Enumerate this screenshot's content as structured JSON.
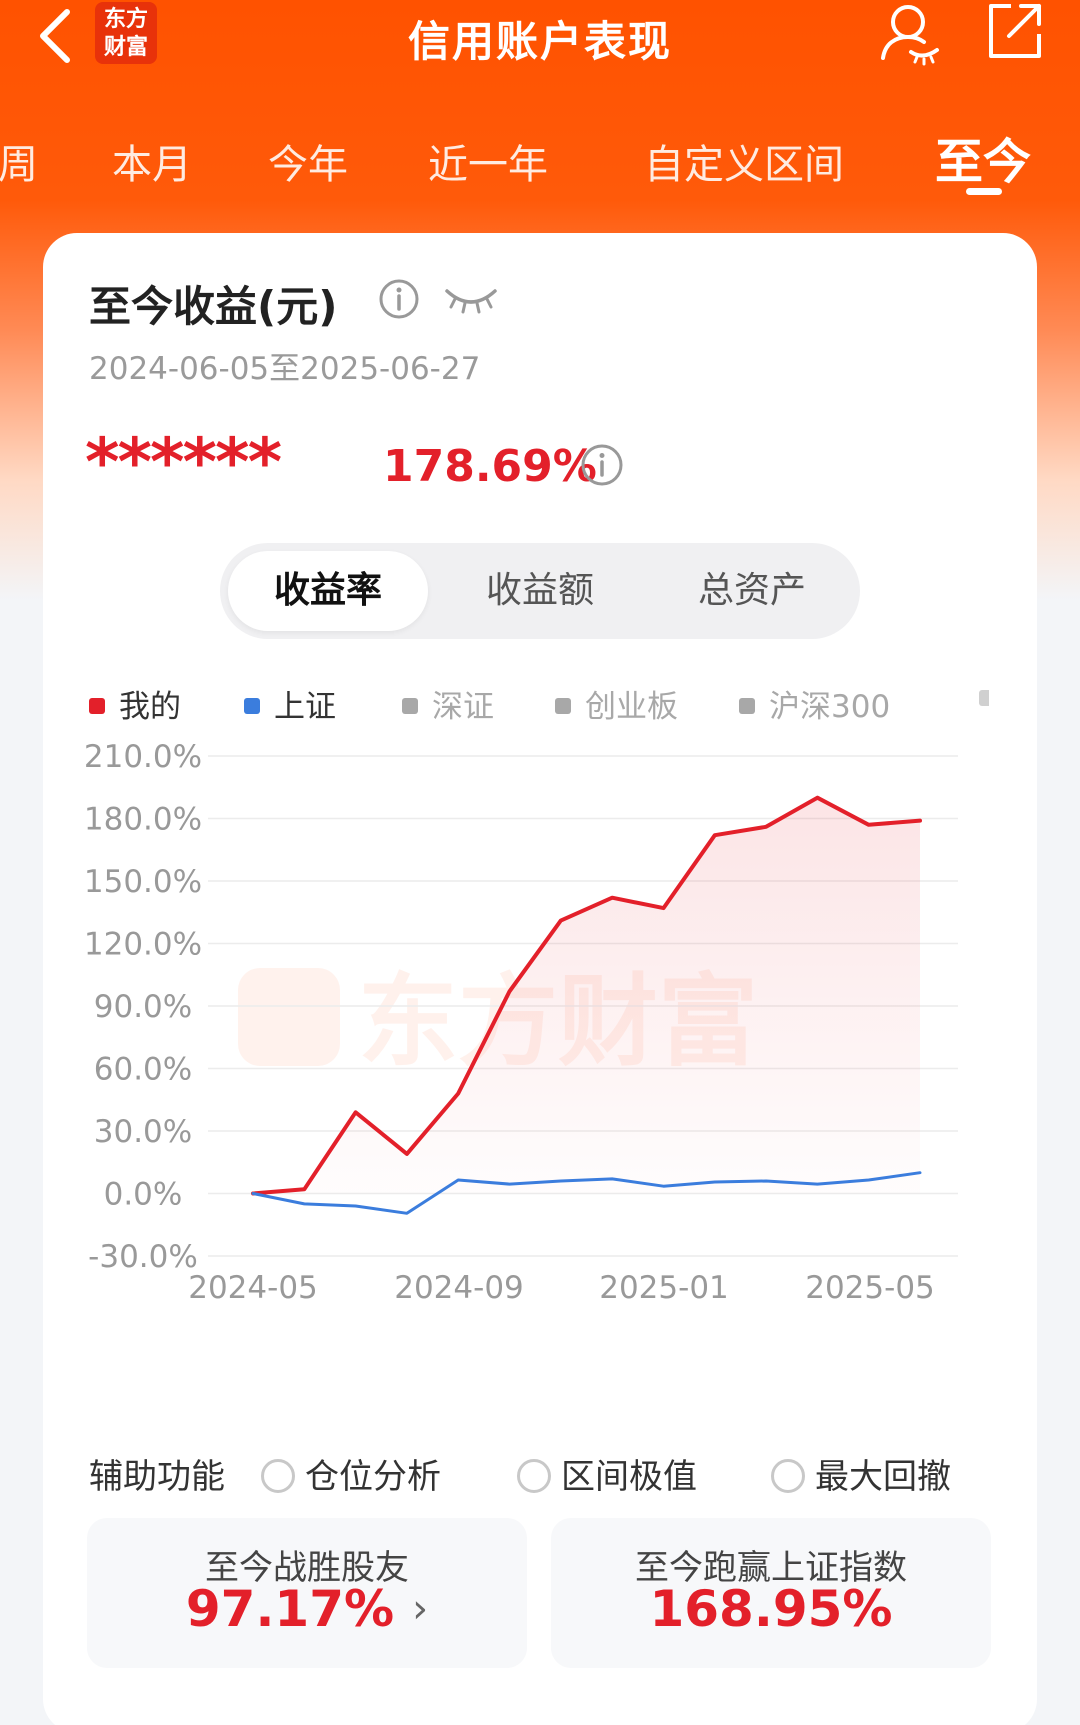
{
  "header": {
    "brand_line1": "东方",
    "brand_line2": "财富",
    "title": "信用账户表现"
  },
  "tabs": [
    {
      "label": "周",
      "active": false
    },
    {
      "label": "本月",
      "active": false
    },
    {
      "label": "今年",
      "active": false
    },
    {
      "label": "近一年",
      "active": false
    },
    {
      "label": "自定义区间",
      "active": false
    },
    {
      "label": "至今",
      "active": true
    }
  ],
  "card": {
    "title": "至今收益(元)",
    "date_range": "2024-06-05至2025-06-27",
    "masked_amount": "******",
    "return_pct": "178.69%",
    "segments": [
      {
        "label": "收益率",
        "active": true
      },
      {
        "label": "收益额",
        "active": false
      },
      {
        "label": "总资产",
        "active": false
      }
    ]
  },
  "legend": [
    {
      "label": "我的",
      "color": "#e3202a",
      "active": true
    },
    {
      "label": "上证",
      "color": "#3b7ddd",
      "active": true
    },
    {
      "label": "深证",
      "color": "#a8a8a8",
      "active": false
    },
    {
      "label": "创业板",
      "color": "#a8a8a8",
      "active": false
    },
    {
      "label": "沪深300",
      "color": "#a8a8a8",
      "active": false
    }
  ],
  "watermark": "东方财富",
  "chart_data": {
    "type": "line",
    "x": [
      "2024-06",
      "2024-07",
      "2024-08",
      "2024-09",
      "2024-10",
      "2024-11",
      "2024-12",
      "2025-01",
      "2025-02",
      "2025-03",
      "2025-04",
      "2025-05",
      "2025-06",
      "2025-06-27"
    ],
    "x_tick_labels": [
      "2024-05",
      "2024-09",
      "2025-01",
      "2025-05"
    ],
    "y_tick_labels": [
      "210.0%",
      "180.0%",
      "150.0%",
      "120.0%",
      "90.0%",
      "60.0%",
      "30.0%",
      "0.0%",
      "-30.0%"
    ],
    "ylim": [
      -30,
      210
    ],
    "series": [
      {
        "name": "我的",
        "color": "#e3202a",
        "area_fill": true,
        "values": [
          0,
          2,
          39,
          19,
          48,
          97,
          131,
          142,
          137,
          172,
          176,
          190,
          177,
          179
        ]
      },
      {
        "name": "上证",
        "color": "#3b7ddd",
        "values": [
          0,
          -5,
          -6,
          -9.5,
          6.5,
          4.5,
          6,
          7,
          3.5,
          5.5,
          6,
          4.5,
          6.5,
          10
        ]
      }
    ],
    "grid": true,
    "legend_position": "top-left"
  },
  "aux": {
    "label": "辅助功能",
    "options": [
      "仓位分析",
      "区间极值",
      "最大回撤"
    ]
  },
  "stats": [
    {
      "label": "至今战胜股友",
      "value": "97.17%",
      "has_chevron": true
    },
    {
      "label": "至今跑赢上证指数",
      "value": "168.95%",
      "has_chevron": false
    }
  ]
}
